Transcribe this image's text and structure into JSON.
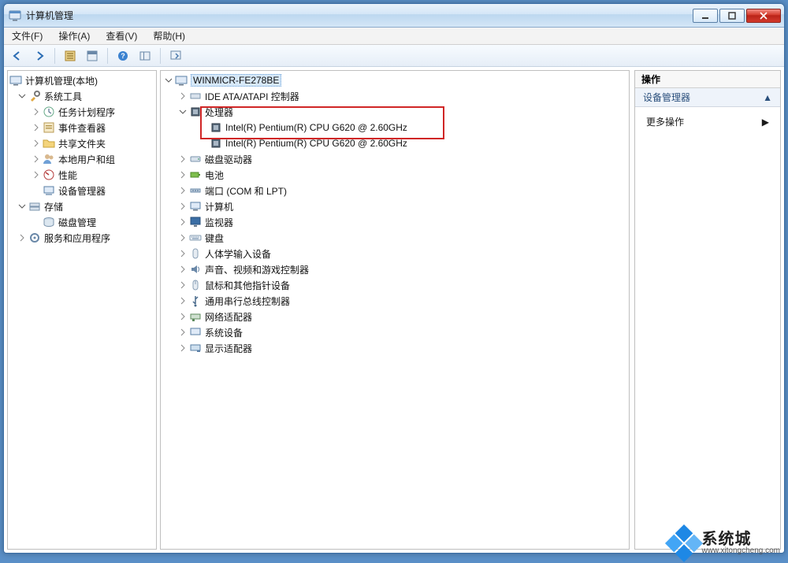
{
  "window_title": "计算机管理",
  "menus": {
    "file": "文件(F)",
    "op": "操作(A)",
    "view": "查看(V)",
    "help": "帮助(H)"
  },
  "left_tree": {
    "root": "计算机管理(本地)",
    "sys_tools": "系统工具",
    "task_scheduler": "任务计划程序",
    "event_viewer": "事件查看器",
    "shared_folders": "共享文件夹",
    "local_users": "本地用户和组",
    "performance": "性能",
    "device_manager": "设备管理器",
    "storage": "存储",
    "disk_mgmt": "磁盘管理",
    "services": "服务和应用程序"
  },
  "center_tree": {
    "computer": "WINMICR-FE278BE",
    "ide": "IDE ATA/ATAPI 控制器",
    "processors": "处理器",
    "cpu1": "Intel(R) Pentium(R) CPU G620 @ 2.60GHz",
    "cpu2": "Intel(R) Pentium(R) CPU G620 @ 2.60GHz",
    "disk_drives": "磁盘驱动器",
    "batteries": "电池",
    "ports": "端口 (COM 和 LPT)",
    "computers": "计算机",
    "monitors": "监视器",
    "keyboards": "键盘",
    "hid": "人体学输入设备",
    "sound": "声音、视频和游戏控制器",
    "mice": "鼠标和其他指针设备",
    "usb": "通用串行总线控制器",
    "network": "网络适配器",
    "sys_devices": "系统设备",
    "display": "显示适配器"
  },
  "actions": {
    "header": "操作",
    "section": "设备管理器",
    "more": "更多操作"
  },
  "watermark": {
    "line1": "系统城",
    "line2": "www.xitongcheng.com"
  }
}
